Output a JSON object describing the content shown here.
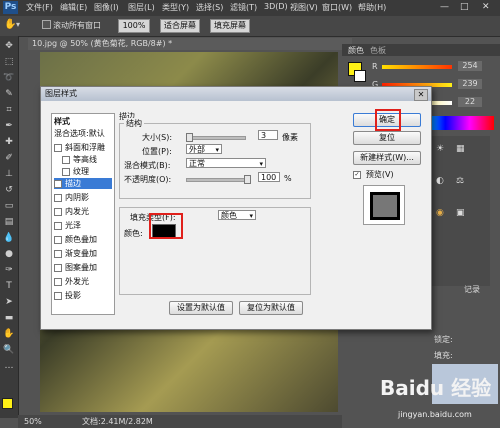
{
  "menubar": {
    "logo": "Ps",
    "items": [
      "文件(F)",
      "编辑(E)",
      "图像(I)",
      "图层(L)",
      "类型(Y)",
      "选择(S)",
      "滤镜(T)",
      "3D(D)",
      "视图(V)",
      "窗口(W)",
      "帮助(H)"
    ],
    "window_controls": [
      "—",
      "□",
      "✕"
    ]
  },
  "options": {
    "scroll_all_label": "滚动所有窗口",
    "zoom": "100%",
    "fit_screen": "适合屏幕",
    "fill_screen": "填充屏幕"
  },
  "document": {
    "tab": "10.jpg @ 50% (黄色菊花, RGB/8#) *",
    "zoom": "50%",
    "doc_size": "文档:2.41M/2.82M"
  },
  "right_panel": {
    "tabs": [
      "颜色",
      "色板"
    ],
    "channels": [
      {
        "label": "R",
        "value": "254",
        "color": "#e0261f"
      },
      {
        "label": "G",
        "value": "239",
        "color": "#43b52c"
      },
      {
        "label": "B",
        "value": "22",
        "color": "#2e3fd8"
      }
    ],
    "foreground_color": "#fef016",
    "layers_fragments": [
      "记录",
      "锁定:",
      "填充:"
    ]
  },
  "dialog": {
    "title": "图层样式",
    "styles_header": "样式",
    "blend_options": "混合选项:默认",
    "style_items": [
      {
        "label": "斜面和浮雕",
        "checked": false
      },
      {
        "label": "等高线",
        "checked": false,
        "indent": true
      },
      {
        "label": "纹理",
        "checked": false,
        "indent": true
      },
      {
        "label": "描边",
        "checked": true,
        "selected": true
      },
      {
        "label": "内阴影",
        "checked": false
      },
      {
        "label": "内发光",
        "checked": false
      },
      {
        "label": "光泽",
        "checked": false
      },
      {
        "label": "颜色叠加",
        "checked": false
      },
      {
        "label": "渐变叠加",
        "checked": false
      },
      {
        "label": "图案叠加",
        "checked": false
      },
      {
        "label": "外发光",
        "checked": false
      },
      {
        "label": "投影",
        "checked": false
      }
    ],
    "stroke_title": "描边",
    "structure_title": "结构",
    "size_label": "大小(S):",
    "size_value": "3",
    "size_unit": "像素",
    "position_label": "位置(P):",
    "position_value": "外部",
    "blend_mode_label": "混合模式(B):",
    "blend_mode_value": "正常",
    "opacity_label": "不透明度(O):",
    "opacity_value": "100",
    "opacity_unit": "%",
    "fill_type_label": "填充类型(F):",
    "fill_type_value": "颜色",
    "color_label": "颜色:",
    "stroke_color": "#000000",
    "set_default": "设置为默认值",
    "reset_default": "复位为默认值",
    "ok": "确定",
    "reset": "复位",
    "new_style": "新建样式(W)...",
    "preview_label": "预览(V)"
  },
  "watermark": {
    "text": "Baidu 经验",
    "url": "jingyan.baidu.com"
  }
}
